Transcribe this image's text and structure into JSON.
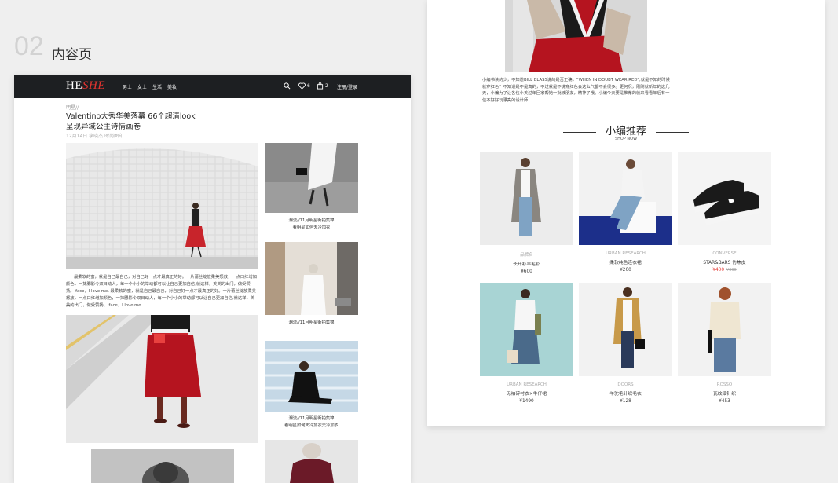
{
  "section": {
    "number": "02",
    "title": "内容页"
  },
  "site": {
    "logo_a": "HE",
    "logo_b": "SHE",
    "nav": [
      "男士",
      "女士",
      "生活",
      "美妆"
    ],
    "fav_count": "6",
    "bag_count": "2",
    "login": "注册/登录"
  },
  "article": {
    "breadcrumb": "明星//",
    "title_line1": "Valentino大秀华美落幕 66个超清look",
    "title_line2": "呈现异域公主诗情画卷",
    "meta": "12月14日  李晓杰  时尚图印",
    "paragraph": "最柔软的蜜，就是自己最自己，对自己好一点才最真正的好。一片蕾丝绽放柔美怒放，一点口红增加颜色，一抹腮影令双目动人，每一个小小的举动都可以让自己更加自信,就这样，美美的出门，做受赞扬。Iface，I love me.  最柔软的蜜，就是自己最自己，对自己好一点才最真正的好。一片蕾丝绽放柔美怒放，一点口红增加颜色，一抹腮影令双目动人，每一个小小的举动都可以让自己更加自信,就这样，美美的出门，做受赞扬。Iface，I love me.",
    "side_caps": [
      "潮流//11月明星街拍集锦\n看明星如何天冷加衣",
      "潮流//11月明星街拍集锦",
      "潮流//11月明星街拍集锦\n看明星如何天冷加衣天冷加衣"
    ]
  },
  "detail": {
    "paragraph": "小编书读的少，不知道BILL BLASS说的是否正确，“WHEN IN DOUBT WEAR RED”,就是不知的时候就穿红色？不知道是不是真的，不过就是不说穿红色会这么气都不会很多。更何况，刚刚就新年的这几天，小编为了让各位小美过年回家帮她一批被朋友，精神了哦。小编今天要是推荐的就来看看年后有一位不好好玩漂亮的设计师......",
    "rec_title": "小编推荐",
    "rec_sub": "SHOP NOW"
  },
  "products": [
    {
      "brand": "品牌名",
      "name": "长开衫羊毛衫",
      "price": "¥600",
      "old": ""
    },
    {
      "brand": "URBAN RESEARCH",
      "name": "柔软纯色连衣裙",
      "price": "¥200",
      "old": ""
    },
    {
      "brand": "CONVERSE",
      "name": "STAR&BARS 仿焦皮",
      "price": "¥400",
      "old": "¥390"
    },
    {
      "brand": "URBAN RESEARCH",
      "name": "无袖碎衬衣×牛仔裙",
      "price": "¥1490",
      "old": ""
    },
    {
      "brand": "DOORS",
      "name": "羊驼毛针织毛衣",
      "price": "¥128",
      "old": ""
    },
    {
      "brand": "ROSSO",
      "name": "瓦纹细针织",
      "price": "¥453",
      "old": ""
    }
  ],
  "colors": {
    "accent": "#e3342f",
    "nav_bg": "#1d1f22"
  },
  "icons": [
    "search-icon",
    "heart-icon",
    "bag-icon"
  ]
}
